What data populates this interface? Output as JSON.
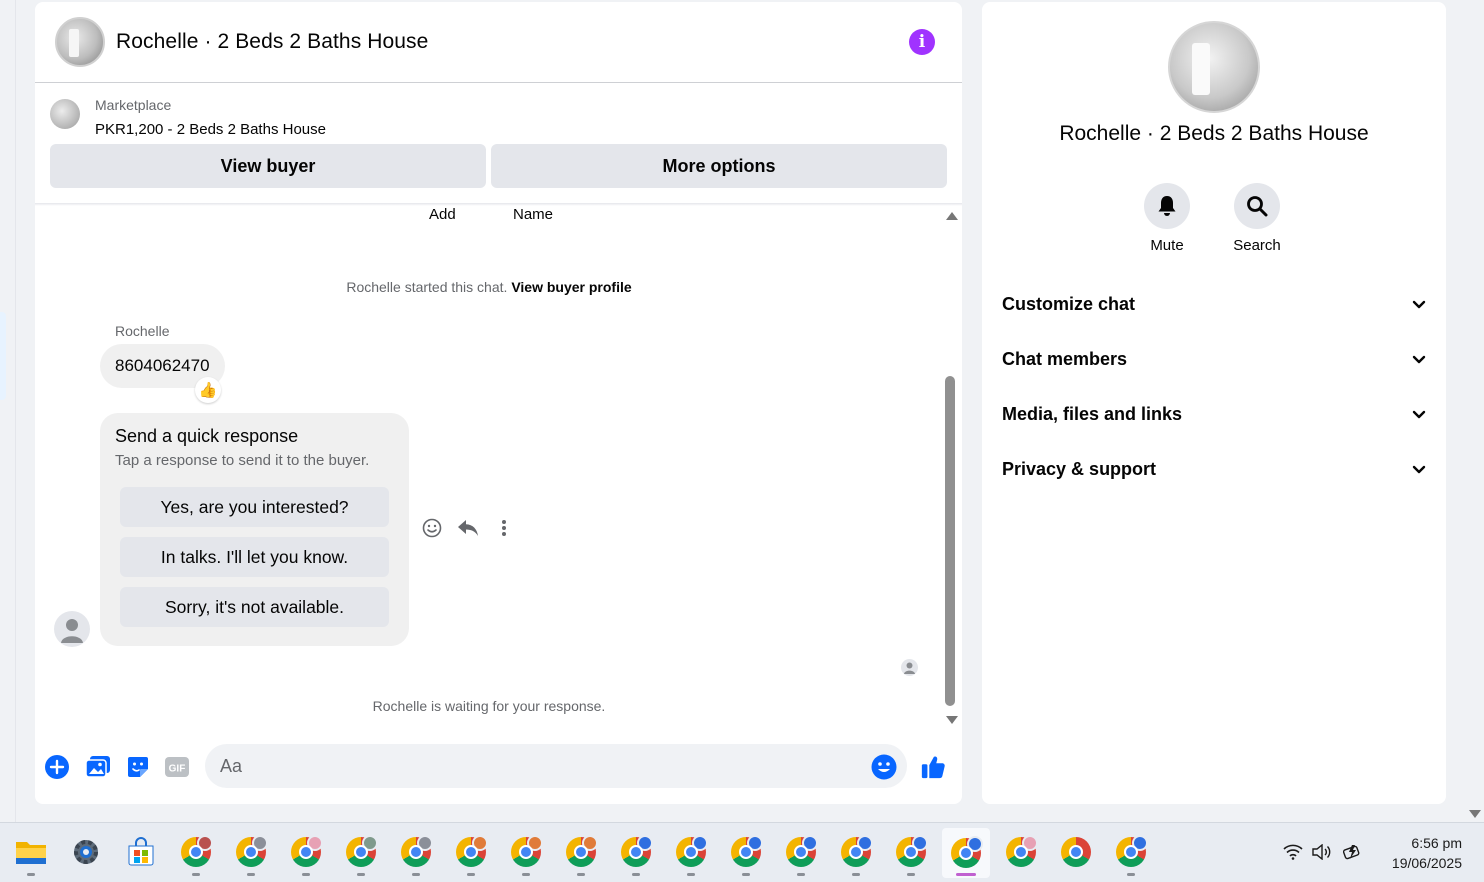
{
  "chat": {
    "title": "Rochelle · 2 Beds 2 Baths House",
    "listing": {
      "source": "Marketplace",
      "price_title": "PKR1,200 - 2 Beds 2 Baths House",
      "view_buyer": "View buyer",
      "more_options": "More options"
    },
    "top_labels": {
      "add": "Add",
      "name": "Name"
    },
    "started_text": "Rochelle started this chat.",
    "view_buyer_profile": "View buyer profile",
    "sender_name": "Rochelle",
    "message": "8604062470",
    "reaction": "👍",
    "quick_response": {
      "title": "Send a quick response",
      "subtitle": "Tap a response to send it to the buyer.",
      "options": [
        "Yes, are you interested?",
        "In talks. I'll let you know.",
        "Sorry, it's not available."
      ]
    },
    "waiting_text": "Rochelle is waiting for your response.",
    "composer": {
      "placeholder": "Aa"
    }
  },
  "info_panel": {
    "title": "Rochelle · 2 Beds 2 Baths House",
    "actions": [
      {
        "label": "Mute",
        "icon": "bell-icon"
      },
      {
        "label": "Search",
        "icon": "search-icon"
      }
    ],
    "sections": [
      "Customize chat",
      "Chat members",
      "Media, files and links",
      "Privacy & support"
    ]
  },
  "taskbar": {
    "apps": [
      "file-explorer",
      "settings",
      "microsoft-store",
      "chrome",
      "chrome",
      "chrome",
      "chrome",
      "chrome",
      "chrome",
      "chrome",
      "chrome",
      "chrome",
      "chrome",
      "chrome",
      "chrome",
      "chrome",
      "chrome",
      "chrome",
      "chrome",
      "chrome"
    ],
    "time": "6:56 pm",
    "date": "19/06/2025"
  },
  "colors": {
    "accent": "#0866ff",
    "info": "#a033ff"
  }
}
